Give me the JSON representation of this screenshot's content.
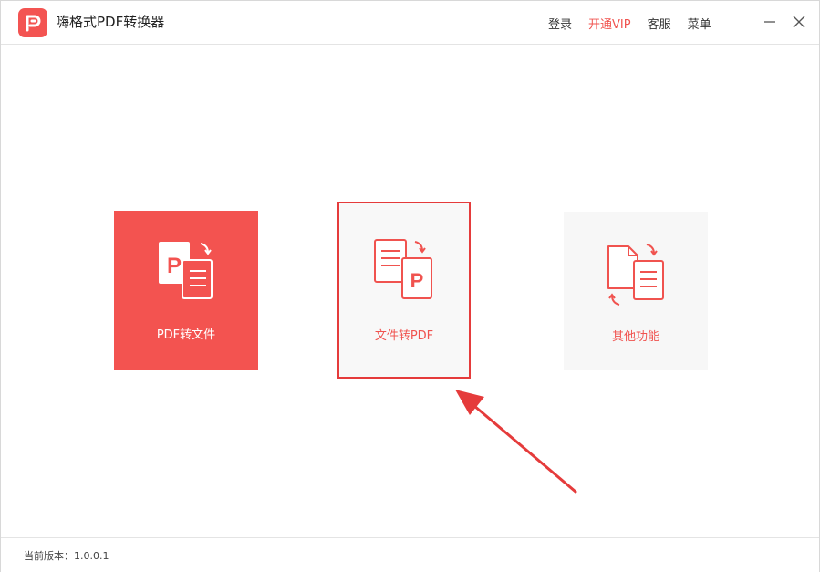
{
  "app": {
    "title": "嗨格式PDF转换器",
    "logo_icon": "pdf-logo-icon",
    "accent_color": "#f35452"
  },
  "top_nav": {
    "login": "登录",
    "vip": "开通VIP",
    "service": "客服",
    "menu": "菜单"
  },
  "window_controls": {
    "minimize_icon": "minimize-icon",
    "close_icon": "close-icon"
  },
  "cards": [
    {
      "label": "PDF转文件",
      "icon": "pdf-to-file-icon",
      "state": "active"
    },
    {
      "label": "文件转PDF",
      "icon": "file-to-pdf-icon",
      "state": "highlighted"
    },
    {
      "label": "其他功能",
      "icon": "other-functions-icon",
      "state": "normal"
    }
  ],
  "annotation": {
    "arrow_icon": "red-pointer-arrow",
    "color": "#e53b3b"
  },
  "footer": {
    "version_text": "当前版本：1.0.0.1"
  }
}
